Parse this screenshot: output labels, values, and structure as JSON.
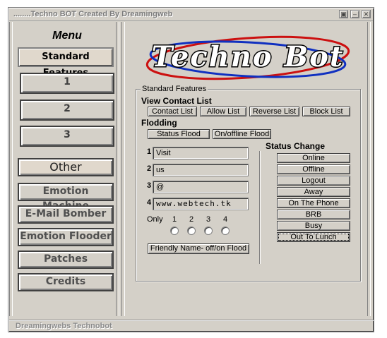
{
  "window": {
    "title": "........Techno BOT Created By Dreamingweb",
    "controls": [
      "restore-icon",
      "minimize-icon",
      "close-icon"
    ]
  },
  "sidebar": {
    "title": "Menu",
    "items": [
      {
        "label": "Standard Features",
        "selected": true
      },
      {
        "label": "1"
      },
      {
        "label": "2"
      },
      {
        "label": "3"
      },
      {
        "label": "Other"
      },
      {
        "label": "Emotion Machine"
      },
      {
        "label": "E-Mail Bomber"
      },
      {
        "label": "Emotion Flooder"
      },
      {
        "label": "Patches"
      },
      {
        "label": "Credits"
      }
    ]
  },
  "logo": {
    "text": "Techno Bot"
  },
  "group": {
    "label": "Standard Features",
    "contact": {
      "heading": "View Contact List",
      "buttons": [
        "Contact List",
        "Allow List",
        "Reverse List",
        "Block List"
      ]
    },
    "flood": {
      "heading": "Flodding",
      "buttons": [
        "Status Flood",
        "On/offline Flood"
      ]
    },
    "fields": [
      {
        "num": "1",
        "value": "Visit"
      },
      {
        "num": "2",
        "value": "us"
      },
      {
        "num": "3",
        "value": "@"
      },
      {
        "num": "4",
        "value": "www.webtech.tk"
      }
    ],
    "only_label": "Only",
    "radios": [
      "1",
      "2",
      "3",
      "4"
    ],
    "friendly_button": "Friendly Name- off/on Flood",
    "status": {
      "heading": "Status Change",
      "buttons": [
        "Online",
        "Offline",
        "Logout",
        "Away",
        "On The Phone",
        "BRB",
        "Busy",
        "Out To Lunch"
      ]
    }
  },
  "statusbar": {
    "text": "Dreamingwebs Technobot"
  },
  "colors": {
    "face": "#d4d0c8",
    "selected_button": "#e0d8cc",
    "logo_ring_red": "#cc1010",
    "logo_ring_blue": "#1030c0"
  }
}
